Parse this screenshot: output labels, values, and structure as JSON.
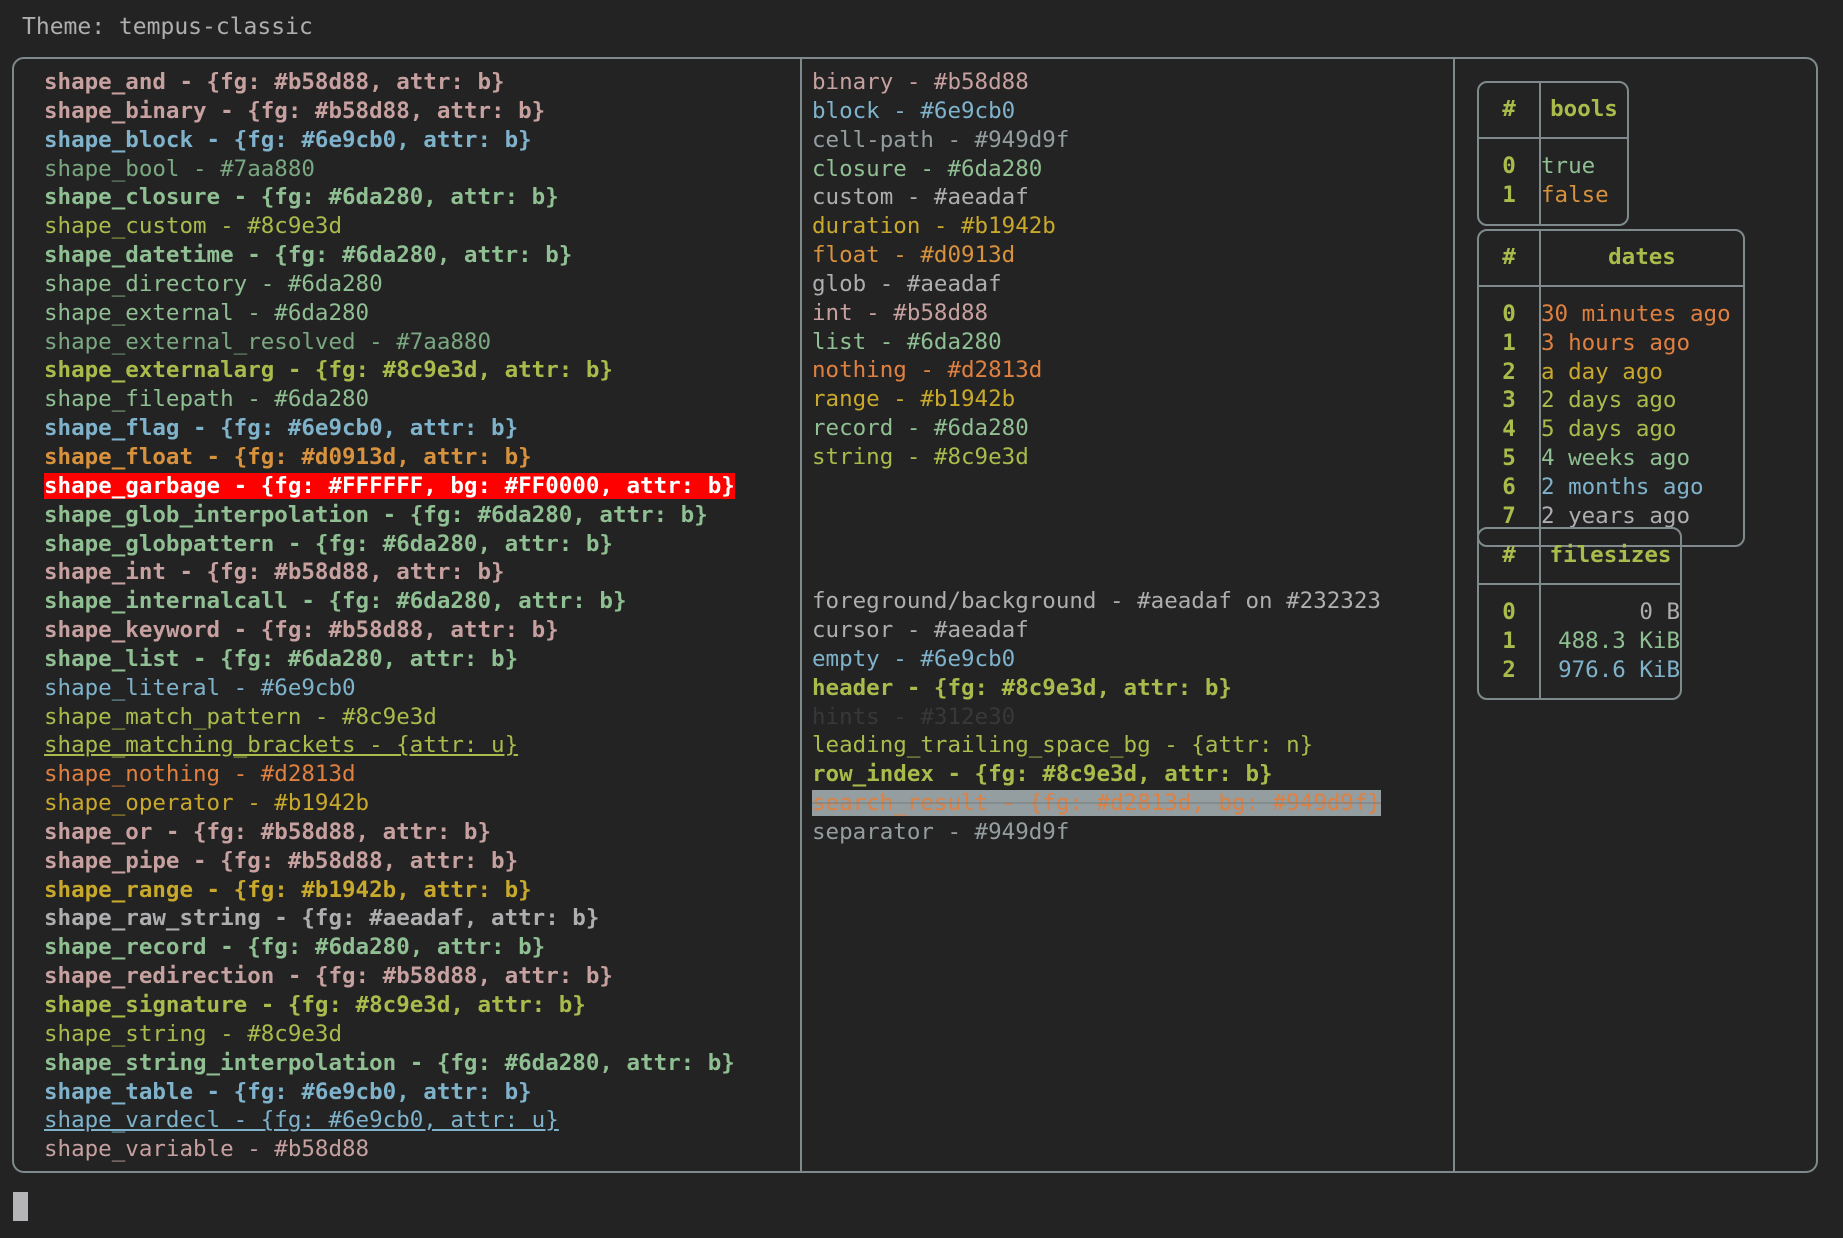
{
  "title": "Theme: tempus-classic",
  "left_column": {
    "name": "shape-definitions-list",
    "lines": [
      {
        "text": "shape_and - {fg: #b58d88, attr: b}",
        "color": "pink",
        "bold": true
      },
      {
        "text": "shape_binary - {fg: #b58d88, attr: b}",
        "color": "pink",
        "bold": true
      },
      {
        "text": "shape_block - {fg: #6e9cb0, attr: b}",
        "color": "blue",
        "bold": true
      },
      {
        "text": "shape_bool - #7aa880",
        "color": "mgreen",
        "bold": false
      },
      {
        "text": "shape_closure - {fg: #6da280, attr: b}",
        "color": "green",
        "bold": true
      },
      {
        "text": "shape_custom - #8c9e3d",
        "color": "olive",
        "bold": false
      },
      {
        "text": "shape_datetime - {fg: #6da280, attr: b}",
        "color": "green",
        "bold": true
      },
      {
        "text": "shape_directory - #6da280",
        "color": "green",
        "bold": false
      },
      {
        "text": "shape_external - #6da280",
        "color": "green",
        "bold": false
      },
      {
        "text": "shape_external_resolved - #7aa880",
        "color": "mgreen",
        "bold": false
      },
      {
        "text": "shape_externalarg - {fg: #8c9e3d, attr: b}",
        "color": "olive",
        "bold": true
      },
      {
        "text": "shape_filepath - #6da280",
        "color": "green",
        "bold": false
      },
      {
        "text": "shape_flag - {fg: #6e9cb0, attr: b}",
        "color": "blue",
        "bold": true
      },
      {
        "text": "shape_float - {fg: #d0913d, attr: b}",
        "color": "orange2",
        "bold": true
      },
      {
        "text": "shape_garbage - {fg: #FFFFFF, bg: #FF0000, attr: b}",
        "color": "garbage",
        "bold": true
      },
      {
        "text": "shape_glob_interpolation - {fg: #6da280, attr: b}",
        "color": "green",
        "bold": true
      },
      {
        "text": "shape_globpattern - {fg: #6da280, attr: b}",
        "color": "green",
        "bold": true
      },
      {
        "text": "shape_int - {fg: #b58d88, attr: b}",
        "color": "pink",
        "bold": true
      },
      {
        "text": "shape_internalcall - {fg: #6da280, attr: b}",
        "color": "green",
        "bold": true
      },
      {
        "text": "shape_keyword - {fg: #b58d88, attr: b}",
        "color": "pink",
        "bold": true
      },
      {
        "text": "shape_list - {fg: #6da280, attr: b}",
        "color": "green",
        "bold": true
      },
      {
        "text": "shape_literal - #6e9cb0",
        "color": "blue",
        "bold": false
      },
      {
        "text": "shape_match_pattern - #8c9e3d",
        "color": "olive",
        "bold": false
      },
      {
        "text": "shape_matching_brackets - {attr: u}",
        "color": "olive",
        "bold": false,
        "underline": true
      },
      {
        "text": "shape_nothing - #d2813d",
        "color": "orange",
        "bold": false
      },
      {
        "text": "shape_operator - #b1942b",
        "color": "yellow",
        "bold": false
      },
      {
        "text": "shape_or - {fg: #b58d88, attr: b}",
        "color": "pink",
        "bold": true
      },
      {
        "text": "shape_pipe - {fg: #b58d88, attr: b}",
        "color": "pink",
        "bold": true
      },
      {
        "text": "shape_range - {fg: #b1942b, attr: b}",
        "color": "yellow",
        "bold": true
      },
      {
        "text": "shape_raw_string - {fg: #aeadaf, attr: b}",
        "color": "grey",
        "bold": true
      },
      {
        "text": "shape_record - {fg: #6da280, attr: b}",
        "color": "green",
        "bold": true
      },
      {
        "text": "shape_redirection - {fg: #b58d88, attr: b}",
        "color": "pink",
        "bold": true
      },
      {
        "text": "shape_signature - {fg: #8c9e3d, attr: b}",
        "color": "olive",
        "bold": true
      },
      {
        "text": "shape_string - #8c9e3d",
        "color": "olive",
        "bold": false
      },
      {
        "text": "shape_string_interpolation - {fg: #6da280, attr: b}",
        "color": "green",
        "bold": true
      },
      {
        "text": "shape_table - {fg: #6e9cb0, attr: b}",
        "color": "blue",
        "bold": true
      },
      {
        "text": "shape_vardecl - {fg: #6e9cb0, attr: u}",
        "color": "blue",
        "bold": false,
        "underline": true
      },
      {
        "text": "shape_variable - #b58d88",
        "color": "pink",
        "bold": false
      }
    ]
  },
  "middle_column": {
    "name": "type-and-ui-colors",
    "types_block": [
      {
        "text": "binary - #b58d88",
        "color": "pink",
        "bold": false
      },
      {
        "text": "block - #6e9cb0",
        "color": "blue",
        "bold": false
      },
      {
        "text": "cell-path - #949d9f",
        "color": "sep",
        "bold": false
      },
      {
        "text": "closure - #6da280",
        "color": "green",
        "bold": false
      },
      {
        "text": "custom - #aeadaf",
        "color": "grey",
        "bold": false
      },
      {
        "text": "duration - #b1942b",
        "color": "yellow",
        "bold": false
      },
      {
        "text": "float - #d0913d",
        "color": "orange2",
        "bold": false
      },
      {
        "text": "glob - #aeadaf",
        "color": "grey",
        "bold": false
      },
      {
        "text": "int - #b58d88",
        "color": "pink",
        "bold": false
      },
      {
        "text": "list - #6da280",
        "color": "green",
        "bold": false
      },
      {
        "text": "nothing - #d2813d",
        "color": "orange",
        "bold": false
      },
      {
        "text": "range - #b1942b",
        "color": "yellow",
        "bold": false
      },
      {
        "text": "record - #6da280",
        "color": "green",
        "bold": false
      },
      {
        "text": "string - #8c9e3d",
        "color": "olive",
        "bold": false
      }
    ],
    "ui_block": [
      {
        "text": "foreground/background - #aeadaf on #232323",
        "color": "grey",
        "bold": false
      },
      {
        "text": "cursor - #aeadaf",
        "color": "grey",
        "bold": false
      },
      {
        "text": "empty - #6e9cb0",
        "color": "blue",
        "bold": false
      },
      {
        "text": "header - {fg: #8c9e3d, attr: b}",
        "color": "olive",
        "bold": true
      },
      {
        "text": "hints - #312e30",
        "color": "dim",
        "bold": false
      },
      {
        "text": "leading_trailing_space_bg - {attr: n}",
        "color": "olive",
        "bold": false
      },
      {
        "text": "row_index - {fg: #8c9e3d, attr: b}",
        "color": "olive",
        "bold": true
      },
      {
        "text": "search_result - {fg: #d2813d, bg: #949d9f}",
        "color": "searchresult",
        "bold": false
      },
      {
        "text": "separator - #949d9f",
        "color": "sep",
        "bold": false
      }
    ]
  },
  "right_column": {
    "tables": [
      {
        "name": "bools-table",
        "index_header": "#",
        "value_header": "bools",
        "align": "left",
        "rows": [
          {
            "index": "0",
            "value": "true",
            "color": "green",
            "bold": false
          },
          {
            "index": "1",
            "value": "false",
            "color": "orange2",
            "bold": false
          }
        ]
      },
      {
        "name": "dates-table",
        "index_header": "#",
        "value_header": "dates",
        "align": "left",
        "rows": [
          {
            "index": "0",
            "value": "30 minutes ago",
            "color": "orange",
            "bold": true
          },
          {
            "index": "1",
            "value": "3 hours ago",
            "color": "orange",
            "bold": false
          },
          {
            "index": "2",
            "value": "a day ago",
            "color": "yellow",
            "bold": false
          },
          {
            "index": "3",
            "value": "2 days ago",
            "color": "olive",
            "bold": false
          },
          {
            "index": "4",
            "value": "5 days ago",
            "color": "olive",
            "bold": true
          },
          {
            "index": "5",
            "value": "4 weeks ago",
            "color": "green",
            "bold": false
          },
          {
            "index": "6",
            "value": "2 months ago",
            "color": "blue",
            "bold": false
          },
          {
            "index": "7",
            "value": "2 years ago",
            "color": "grey",
            "bold": false
          }
        ]
      },
      {
        "name": "filesizes-table",
        "index_header": "#",
        "value_header": "filesizes",
        "align": "right",
        "rows": [
          {
            "index": "0",
            "value": "0 B",
            "color": "grey",
            "bold": false
          },
          {
            "index": "1",
            "value": "488.3 KiB",
            "color": "green",
            "bold": false
          },
          {
            "index": "2",
            "value": "976.6 KiB",
            "color": "blue",
            "bold": false
          }
        ]
      }
    ]
  },
  "colors": {
    "background": "#232323",
    "foreground": "#aeadaf",
    "border": "#7f8a8c",
    "garbage_bg": "#FF0000",
    "garbage_fg": "#FFFFFF",
    "search_bg": "#949d9f"
  }
}
